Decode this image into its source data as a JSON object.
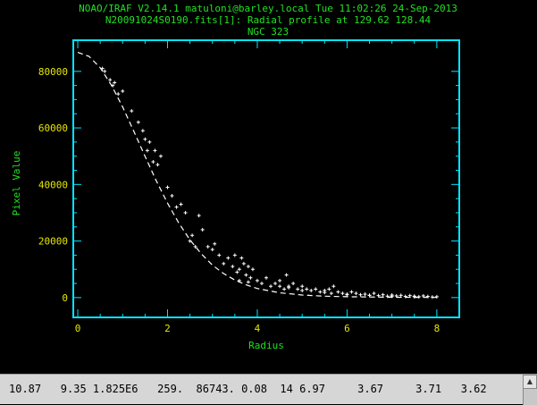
{
  "header": {
    "line1": "NOAO/IRAF V2.14.1 matuloni@barley.local Tue 11:02:26 24-Sep-2013",
    "line2": "N20091024S0190.fits[1]: Radial profile at 129.62 128.44",
    "line3": "NGC 323"
  },
  "colors": {
    "frame": "#00e5ff",
    "header_text": "#22e022",
    "tick_labels": "#e6e600",
    "data": "#ffffff"
  },
  "status_bar": {
    "text": "10.87   9.35 1.825E6   259.  86743. 0.08  14 6.97     3.67     3.71   3.62",
    "scroll_up_glyph": "▲"
  },
  "chart_data": {
    "type": "scatter",
    "xlabel": "Radius",
    "ylabel": "Pixel Value",
    "xlim": [
      -0.1,
      8.5
    ],
    "ylim": [
      -7000,
      91000
    ],
    "xticks": [
      0,
      2,
      4,
      6,
      8
    ],
    "yticks": [
      0,
      20000,
      40000,
      60000,
      80000
    ],
    "xtick_labels": [
      "0",
      "2",
      "4",
      "6",
      "8"
    ],
    "ytick_labels": [
      "0",
      "20000",
      "40000",
      "60000",
      "80000"
    ],
    "grid": false,
    "legend": "none",
    "fit": {
      "style": "dashed",
      "x": [
        0,
        0.25,
        0.5,
        0.75,
        1.0,
        1.25,
        1.5,
        1.75,
        2.0,
        2.25,
        2.5,
        2.75,
        3.0,
        3.25,
        3.5,
        3.75,
        4.0,
        4.5,
        5.0,
        5.5,
        6.0,
        6.5,
        7.0,
        7.5,
        8.0
      ],
      "y": [
        86700,
        85300,
        81300,
        75100,
        67400,
        58800,
        49900,
        41300,
        33400,
        26400,
        20400,
        15500,
        11500,
        8500,
        6200,
        4500,
        3200,
        1700,
        900,
        500,
        300,
        200,
        120,
        80,
        50
      ]
    },
    "points": {
      "x": [
        0.55,
        0.6,
        0.72,
        0.78,
        0.82,
        0.9,
        1.0,
        1.2,
        1.35,
        1.45,
        1.5,
        1.55,
        1.6,
        1.68,
        1.72,
        1.78,
        1.85,
        2.0,
        2.1,
        2.2,
        2.3,
        2.4,
        2.5,
        2.55,
        2.62,
        2.7,
        2.78,
        2.9,
        3.0,
        3.05,
        3.15,
        3.25,
        3.35,
        3.45,
        3.5,
        3.55,
        3.6,
        3.65,
        3.7,
        3.75,
        3.8,
        3.85,
        3.9,
        4.0,
        4.1,
        4.2,
        4.3,
        4.4,
        4.5,
        4.6,
        4.65,
        4.7,
        4.8,
        4.9,
        5.0,
        5.1,
        5.2,
        5.3,
        5.4,
        5.5,
        5.6,
        5.65,
        5.7,
        5.8,
        5.9,
        6.0,
        6.1,
        6.2,
        6.3,
        6.4,
        6.5,
        6.6,
        6.7,
        6.8,
        6.9,
        7.0,
        7.1,
        7.2,
        7.3,
        7.4,
        7.5,
        7.6,
        7.7,
        7.8,
        7.9,
        8.0,
        3.6,
        3.8,
        4.5,
        4.7,
        5.0,
        5.5,
        6.0,
        6.5,
        7.0,
        7.5
      ],
      "y": [
        81000,
        80000,
        77000,
        75000,
        76000,
        72000,
        73000,
        66000,
        62000,
        59000,
        56000,
        52000,
        55000,
        48000,
        52000,
        47000,
        50000,
        39000,
        36000,
        32000,
        33000,
        30000,
        20000,
        22000,
        18000,
        29000,
        24000,
        18000,
        17000,
        19000,
        15000,
        12000,
        14000,
        11000,
        15000,
        9000,
        10000,
        14000,
        12000,
        8000,
        11000,
        7000,
        10000,
        6000,
        5000,
        7000,
        4000,
        5000,
        6000,
        3000,
        8000,
        4000,
        5000,
        3000,
        4000,
        3000,
        2500,
        3000,
        2000,
        2500,
        3000,
        1500,
        4000,
        2000,
        1500,
        1000,
        2000,
        1500,
        1000,
        1200,
        800,
        1500,
        700,
        1000,
        500,
        900,
        600,
        800,
        400,
        700,
        500,
        300,
        600,
        400,
        200,
        300,
        6000,
        5500,
        4000,
        3500,
        2500,
        1800,
        1200,
        800,
        500,
        300
      ]
    }
  }
}
